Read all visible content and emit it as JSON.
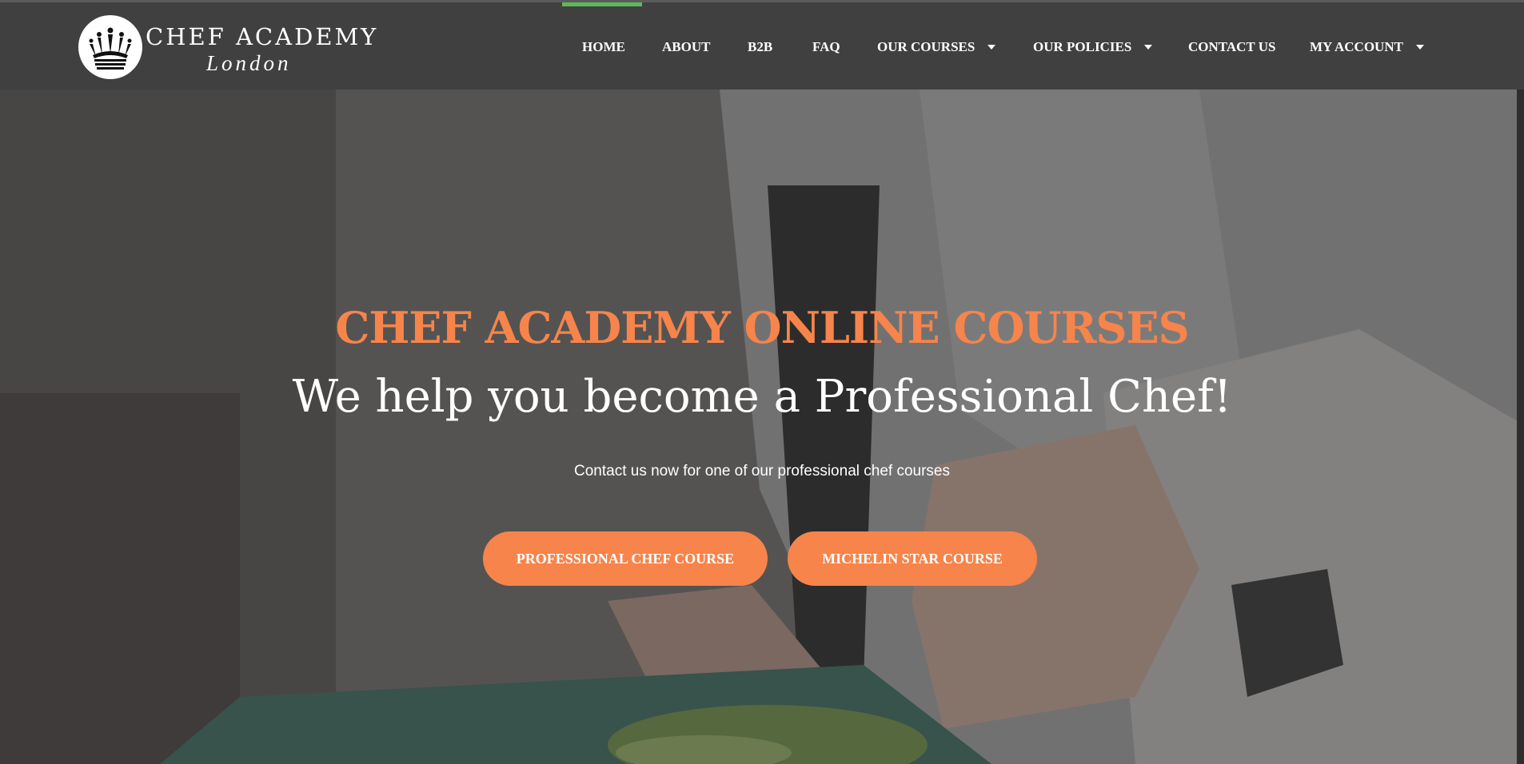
{
  "brand": {
    "name": "CHEF ACADEMY",
    "city": "London",
    "logo_icon": "crown-icon"
  },
  "nav": {
    "items": [
      {
        "label": "HOME",
        "active": true,
        "dropdown": false
      },
      {
        "label": "ABOUT",
        "active": false,
        "dropdown": false
      },
      {
        "label": "B2B",
        "active": false,
        "dropdown": false
      },
      {
        "label": "FAQ",
        "active": false,
        "dropdown": false
      },
      {
        "label": "OUR COURSES",
        "active": false,
        "dropdown": true
      },
      {
        "label": "OUR POLICIES",
        "active": false,
        "dropdown": true
      },
      {
        "label": "CONTACT US",
        "active": false,
        "dropdown": false
      },
      {
        "label": "MY ACCOUNT",
        "active": false,
        "dropdown": true
      }
    ]
  },
  "hero": {
    "title": "CHEF ACADEMY ONLINE COURSES",
    "subtitle": "We help you become a Professional Chef!",
    "text": "Contact us now for one of our professional chef courses",
    "buttons": [
      {
        "label": "PROFESSIONAL CHEF COURSE"
      },
      {
        "label": "MICHELIN STAR COURSE"
      }
    ]
  },
  "colors": {
    "header_bg": "#404040",
    "accent": "#f7844a",
    "active_indicator": "#5cb85c",
    "text": "#ffffff"
  }
}
